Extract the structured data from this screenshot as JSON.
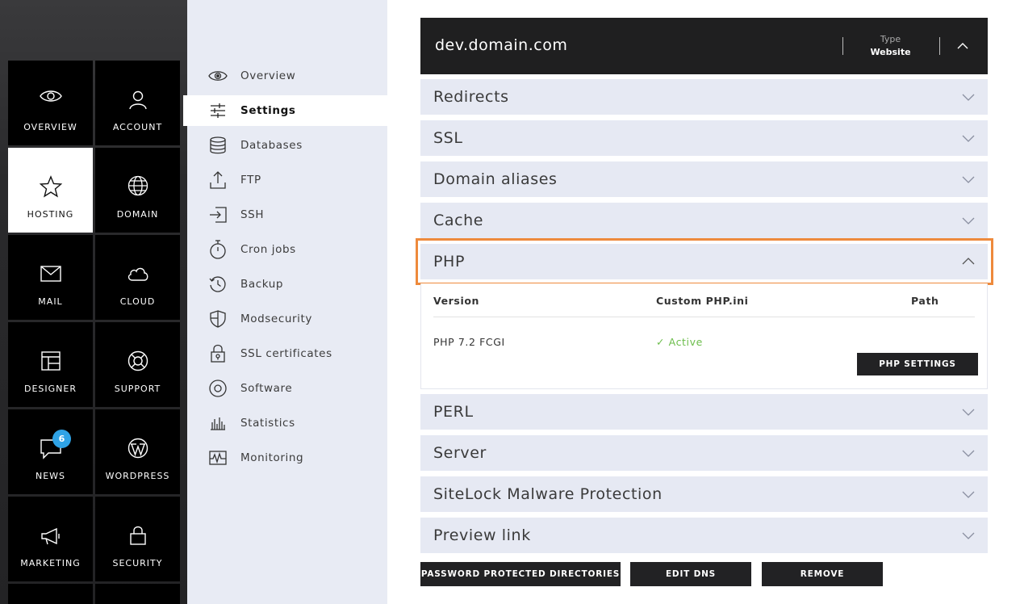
{
  "nav_tiles": [
    {
      "label": "OVERVIEW",
      "icon": "eye-icon"
    },
    {
      "label": "ACCOUNT",
      "icon": "user-icon"
    },
    {
      "label": "HOSTING",
      "icon": "star-icon",
      "active": true
    },
    {
      "label": "DOMAIN",
      "icon": "globe-icon"
    },
    {
      "label": "MAIL",
      "icon": "envelope-icon"
    },
    {
      "label": "CLOUD",
      "icon": "cloud-icon"
    },
    {
      "label": "DESIGNER",
      "icon": "layout-icon"
    },
    {
      "label": "SUPPORT",
      "icon": "lifebuoy-icon"
    },
    {
      "label": "NEWS",
      "icon": "chat-icon",
      "badge": "6"
    },
    {
      "label": "WORDPRESS",
      "icon": "wordpress-icon"
    },
    {
      "label": "MARKETING",
      "icon": "megaphone-icon"
    },
    {
      "label": "SECURITY",
      "icon": "lock-icon"
    }
  ],
  "submenu": [
    {
      "label": "Overview",
      "icon": "eye-icon"
    },
    {
      "label": "Settings",
      "icon": "sliders-icon",
      "active": true
    },
    {
      "label": "Databases",
      "icon": "database-icon"
    },
    {
      "label": "FTP",
      "icon": "upload-icon"
    },
    {
      "label": "SSH",
      "icon": "login-icon"
    },
    {
      "label": "Cron jobs",
      "icon": "stopwatch-icon"
    },
    {
      "label": "Backup",
      "icon": "history-icon"
    },
    {
      "label": "Modsecurity",
      "icon": "shield-icon"
    },
    {
      "label": "SSL certificates",
      "icon": "certificate-lock-icon"
    },
    {
      "label": "Software",
      "icon": "disc-icon"
    },
    {
      "label": "Statistics",
      "icon": "bar-chart-icon"
    },
    {
      "label": "Monitoring",
      "icon": "pulse-icon"
    }
  ],
  "header": {
    "domain": "dev.domain.com",
    "type_label": "Type",
    "type_value": "Website"
  },
  "sections_before": [
    "Redirects",
    "SSL",
    "Domain aliases",
    "Cache"
  ],
  "php": {
    "title": "PHP",
    "headers": {
      "version": "Version",
      "custom": "Custom PHP.ini",
      "path": "Path"
    },
    "row": {
      "version": "PHP 7.2 FCGI",
      "custom": "✓ Active",
      "path": ""
    },
    "button": "PHP SETTINGS"
  },
  "sections_after": [
    "PERL",
    "Server",
    "SiteLock Malware Protection",
    "Preview link"
  ],
  "bottom_buttons": [
    "PASSWORD PROTECTED DIRECTORIES",
    "EDIT DNS",
    "REMOVE"
  ],
  "colors": {
    "highlight": "#ee8a3c",
    "badge": "#2fa3e6",
    "active_status": "#6bbd4a"
  }
}
